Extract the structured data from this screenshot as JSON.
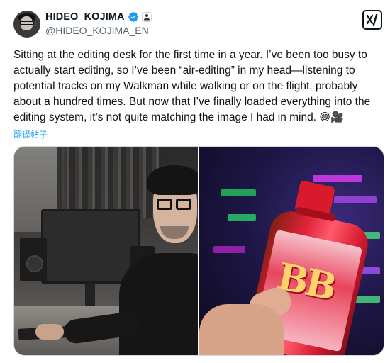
{
  "header": {
    "display_name": "HIDEO_KOJIMA",
    "handle": "@HIDEO_KOJIMA_EN",
    "affiliate_glyph": "👤",
    "x_badge": "x∕"
  },
  "tweet": {
    "text": "Sitting at the editing desk for the first time in a year. I’ve been too busy to actually start editing, so I’ve been “air-editing” in my head—listening to potential tracks on my Walkman while walking or on the flight, probably about a hundred times. But now that I’ve finally loaded everything into the editing system, it’s not quite matching the image I had in mind. ",
    "emoji": "😅🎥",
    "translate_label": "翻译帖子"
  },
  "colors": {
    "text": "#0f1419",
    "secondary": "#536471",
    "link": "#1d9bf0",
    "verified": "#1d9bf0"
  },
  "icons": {
    "verified": "verified-badge-icon",
    "affiliate": "affiliate-badge-icon",
    "x_badge": "x-logo-icon"
  }
}
